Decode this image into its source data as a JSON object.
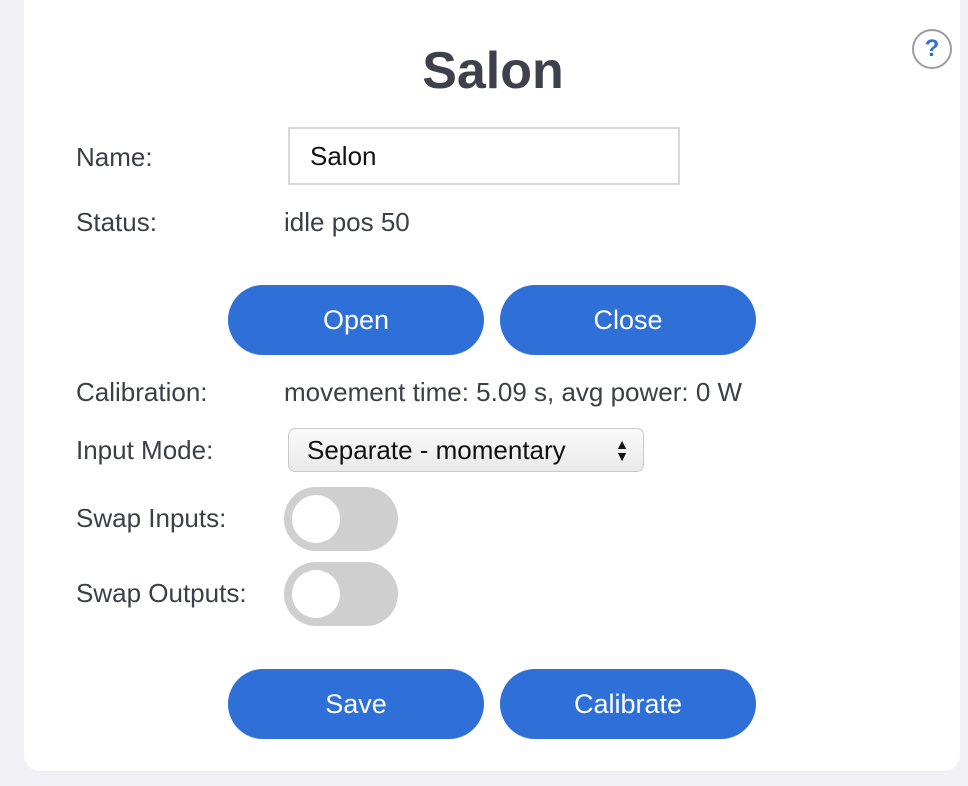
{
  "device": {
    "title": "Salon"
  },
  "help": {
    "icon": "help-icon",
    "label": "?"
  },
  "fields": {
    "name_label": "Name:",
    "name_value": "Salon",
    "status_label": "Status:",
    "status_value": "idle pos 50",
    "calibration_label": "Calibration:",
    "calibration_value": "movement time: 5.09 s, avg power: 0 W",
    "input_mode_label": "Input Mode:",
    "input_mode_value": "Separate - momentary",
    "swap_inputs_label": "Swap Inputs:",
    "swap_inputs_on": false,
    "swap_outputs_label": "Swap Outputs:",
    "swap_outputs_on": false
  },
  "buttons": {
    "open": "Open",
    "close": "Close",
    "save": "Save",
    "calibrate": "Calibrate"
  },
  "colors": {
    "accent": "#2f6fd8",
    "toggle_off": "#cfcfcf",
    "background": "#f1f1f5"
  }
}
